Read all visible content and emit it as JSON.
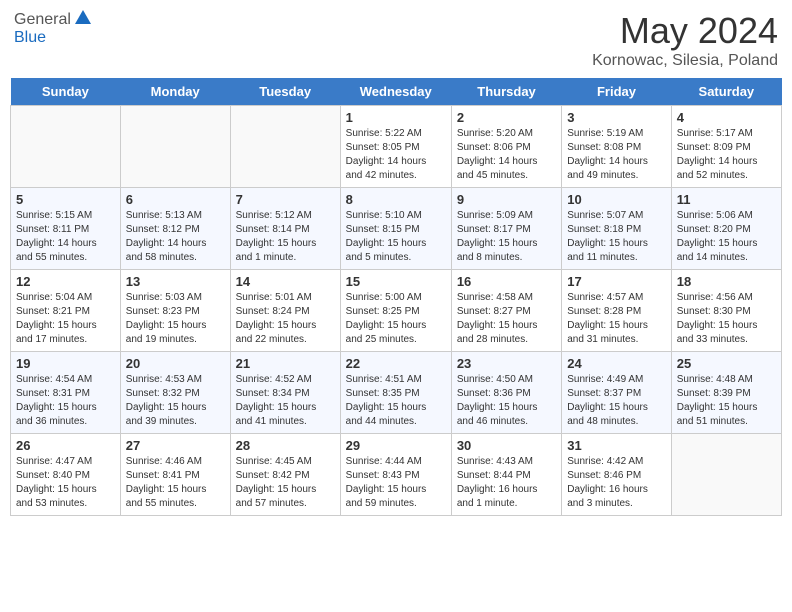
{
  "header": {
    "logo_line1": "General",
    "logo_line2": "Blue",
    "month_title": "May 2024",
    "location": "Kornowac, Silesia, Poland"
  },
  "weekdays": [
    "Sunday",
    "Monday",
    "Tuesday",
    "Wednesday",
    "Thursday",
    "Friday",
    "Saturday"
  ],
  "weeks": [
    [
      {
        "day": "",
        "info": ""
      },
      {
        "day": "",
        "info": ""
      },
      {
        "day": "",
        "info": ""
      },
      {
        "day": "1",
        "info": "Sunrise: 5:22 AM\nSunset: 8:05 PM\nDaylight: 14 hours\nand 42 minutes."
      },
      {
        "day": "2",
        "info": "Sunrise: 5:20 AM\nSunset: 8:06 PM\nDaylight: 14 hours\nand 45 minutes."
      },
      {
        "day": "3",
        "info": "Sunrise: 5:19 AM\nSunset: 8:08 PM\nDaylight: 14 hours\nand 49 minutes."
      },
      {
        "day": "4",
        "info": "Sunrise: 5:17 AM\nSunset: 8:09 PM\nDaylight: 14 hours\nand 52 minutes."
      }
    ],
    [
      {
        "day": "5",
        "info": "Sunrise: 5:15 AM\nSunset: 8:11 PM\nDaylight: 14 hours\nand 55 minutes."
      },
      {
        "day": "6",
        "info": "Sunrise: 5:13 AM\nSunset: 8:12 PM\nDaylight: 14 hours\nand 58 minutes."
      },
      {
        "day": "7",
        "info": "Sunrise: 5:12 AM\nSunset: 8:14 PM\nDaylight: 15 hours\nand 1 minute."
      },
      {
        "day": "8",
        "info": "Sunrise: 5:10 AM\nSunset: 8:15 PM\nDaylight: 15 hours\nand 5 minutes."
      },
      {
        "day": "9",
        "info": "Sunrise: 5:09 AM\nSunset: 8:17 PM\nDaylight: 15 hours\nand 8 minutes."
      },
      {
        "day": "10",
        "info": "Sunrise: 5:07 AM\nSunset: 8:18 PM\nDaylight: 15 hours\nand 11 minutes."
      },
      {
        "day": "11",
        "info": "Sunrise: 5:06 AM\nSunset: 8:20 PM\nDaylight: 15 hours\nand 14 minutes."
      }
    ],
    [
      {
        "day": "12",
        "info": "Sunrise: 5:04 AM\nSunset: 8:21 PM\nDaylight: 15 hours\nand 17 minutes."
      },
      {
        "day": "13",
        "info": "Sunrise: 5:03 AM\nSunset: 8:23 PM\nDaylight: 15 hours\nand 19 minutes."
      },
      {
        "day": "14",
        "info": "Sunrise: 5:01 AM\nSunset: 8:24 PM\nDaylight: 15 hours\nand 22 minutes."
      },
      {
        "day": "15",
        "info": "Sunrise: 5:00 AM\nSunset: 8:25 PM\nDaylight: 15 hours\nand 25 minutes."
      },
      {
        "day": "16",
        "info": "Sunrise: 4:58 AM\nSunset: 8:27 PM\nDaylight: 15 hours\nand 28 minutes."
      },
      {
        "day": "17",
        "info": "Sunrise: 4:57 AM\nSunset: 8:28 PM\nDaylight: 15 hours\nand 31 minutes."
      },
      {
        "day": "18",
        "info": "Sunrise: 4:56 AM\nSunset: 8:30 PM\nDaylight: 15 hours\nand 33 minutes."
      }
    ],
    [
      {
        "day": "19",
        "info": "Sunrise: 4:54 AM\nSunset: 8:31 PM\nDaylight: 15 hours\nand 36 minutes."
      },
      {
        "day": "20",
        "info": "Sunrise: 4:53 AM\nSunset: 8:32 PM\nDaylight: 15 hours\nand 39 minutes."
      },
      {
        "day": "21",
        "info": "Sunrise: 4:52 AM\nSunset: 8:34 PM\nDaylight: 15 hours\nand 41 minutes."
      },
      {
        "day": "22",
        "info": "Sunrise: 4:51 AM\nSunset: 8:35 PM\nDaylight: 15 hours\nand 44 minutes."
      },
      {
        "day": "23",
        "info": "Sunrise: 4:50 AM\nSunset: 8:36 PM\nDaylight: 15 hours\nand 46 minutes."
      },
      {
        "day": "24",
        "info": "Sunrise: 4:49 AM\nSunset: 8:37 PM\nDaylight: 15 hours\nand 48 minutes."
      },
      {
        "day": "25",
        "info": "Sunrise: 4:48 AM\nSunset: 8:39 PM\nDaylight: 15 hours\nand 51 minutes."
      }
    ],
    [
      {
        "day": "26",
        "info": "Sunrise: 4:47 AM\nSunset: 8:40 PM\nDaylight: 15 hours\nand 53 minutes."
      },
      {
        "day": "27",
        "info": "Sunrise: 4:46 AM\nSunset: 8:41 PM\nDaylight: 15 hours\nand 55 minutes."
      },
      {
        "day": "28",
        "info": "Sunrise: 4:45 AM\nSunset: 8:42 PM\nDaylight: 15 hours\nand 57 minutes."
      },
      {
        "day": "29",
        "info": "Sunrise: 4:44 AM\nSunset: 8:43 PM\nDaylight: 15 hours\nand 59 minutes."
      },
      {
        "day": "30",
        "info": "Sunrise: 4:43 AM\nSunset: 8:44 PM\nDaylight: 16 hours\nand 1 minute."
      },
      {
        "day": "31",
        "info": "Sunrise: 4:42 AM\nSunset: 8:46 PM\nDaylight: 16 hours\nand 3 minutes."
      },
      {
        "day": "",
        "info": ""
      }
    ]
  ]
}
